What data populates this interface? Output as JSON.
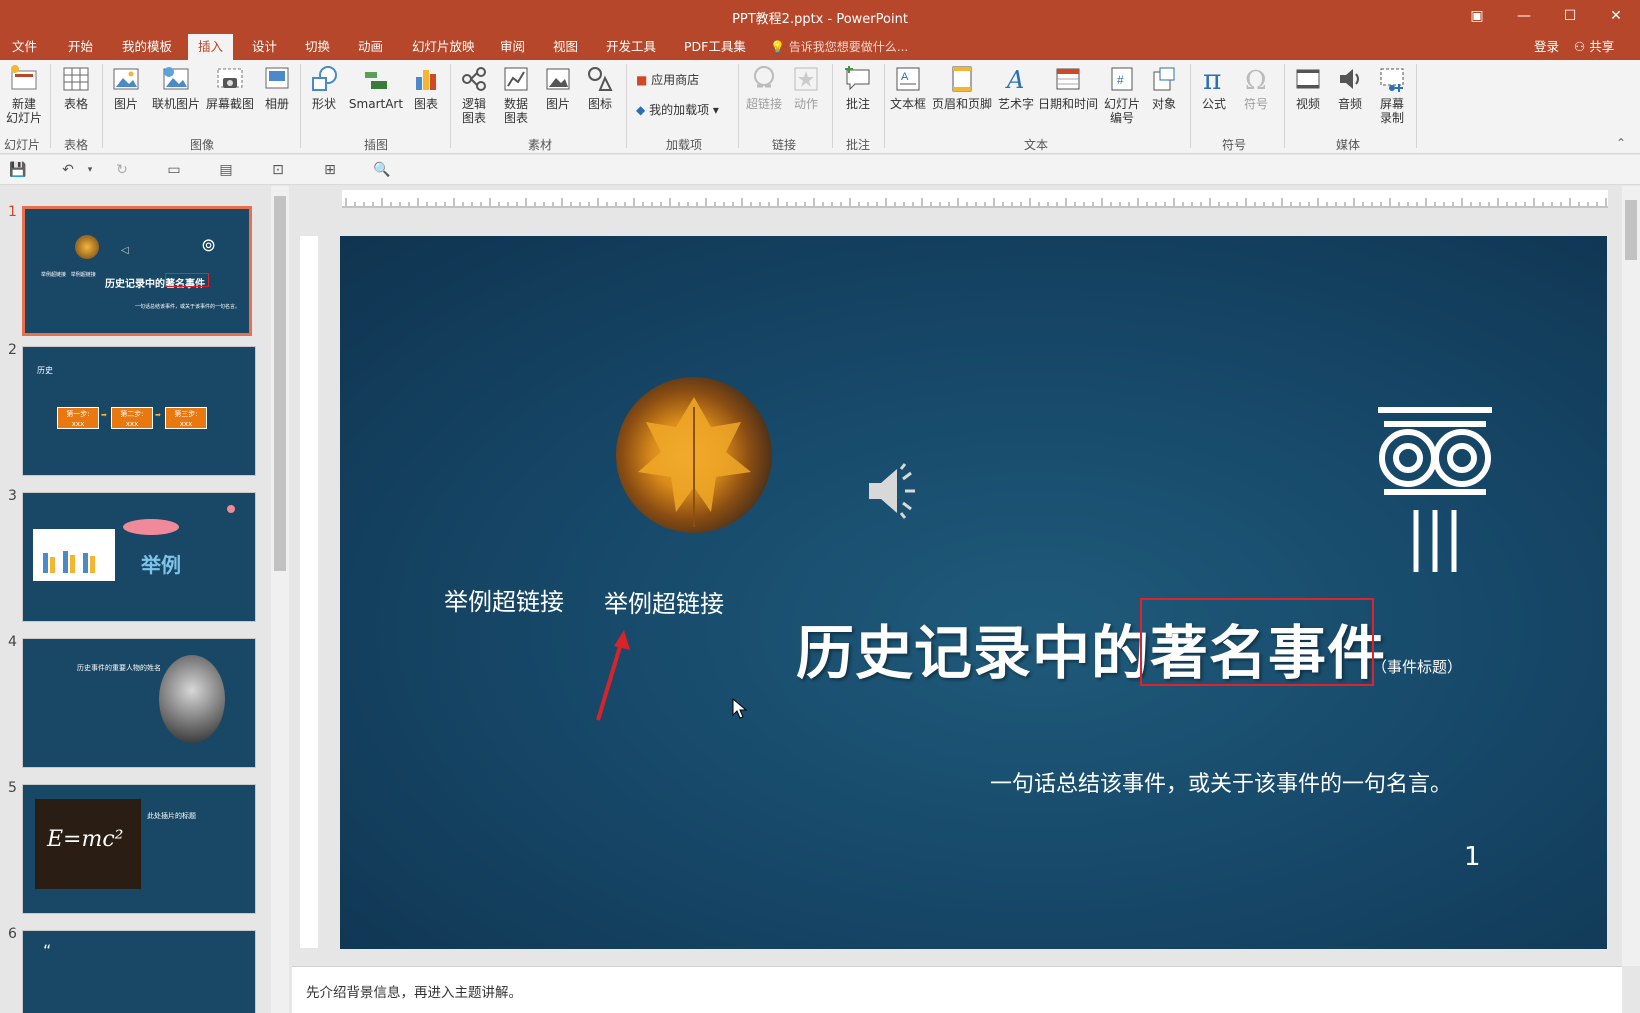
{
  "window": {
    "title": "PPT教程2.pptx - PowerPoint"
  },
  "tabs": [
    "文件",
    "开始",
    "我的模板",
    "插入",
    "设计",
    "切换",
    "动画",
    "幻灯片放映",
    "审阅",
    "视图",
    "开发工具",
    "PDF工具集"
  ],
  "active_tab": "插入",
  "tell_me": "告诉我您想要做什么...",
  "account": {
    "login": "登录",
    "share": "共享"
  },
  "ribbon": {
    "new_slide": "新建\n幻灯片",
    "table": "表格",
    "picture": "图片",
    "online_picture": "联机图片",
    "screenshot": "屏幕截图",
    "album": "相册",
    "shapes": "形状",
    "smartart": "SmartArt",
    "chart": "图表",
    "logic_chart": "逻辑\n图表",
    "data_chart": "数据\n图表",
    "material_picture": "图片",
    "icon": "图标",
    "app_store": "应用商店",
    "my_addins": "我的加载项",
    "hyperlink": "超链接",
    "action": "动作",
    "comment": "批注",
    "textbox": "文本框",
    "header_footer": "页眉和页脚",
    "wordart": "艺术字",
    "datetime": "日期和时间",
    "slide_number": "幻灯片\n编号",
    "object": "对象",
    "equation": "公式",
    "symbol": "符号",
    "video": "视频",
    "audio": "音频",
    "screen_record": "屏幕\n录制",
    "groups": {
      "slides": "幻灯片",
      "tables": "表格",
      "images": "图像",
      "illustrations": "插图",
      "material": "素材",
      "addins": "加载项",
      "links": "链接",
      "comments": "批注",
      "text": "文本",
      "symbols": "符号",
      "media": "媒体"
    }
  },
  "thumbnails": {
    "numbers": [
      "1",
      "2",
      "3",
      "4",
      "5",
      "6"
    ],
    "t1_title": "历史记录中的著名事件",
    "t2_title": "历史",
    "t2_steps": [
      "第一步:",
      "第二步:",
      "第三步:"
    ],
    "t3_title": "举例",
    "t4_title": "历史事件的重要人物的姓名",
    "t5_title": "此处插片的标题",
    "t5_formula": "E=mc²"
  },
  "slide": {
    "link1": "举例超链接",
    "link2": "举例超链接",
    "title_part1": "历史记录中的",
    "title_part2": "著名事件",
    "title_note": "（事件标题）",
    "subtitle": "一句话总结该事件，或关于该事件的一句名言。",
    "page_number": "1"
  },
  "notes": "先介绍背景信息，再进入主题讲解。",
  "colors": {
    "accent": "#b7472a",
    "slide_bg": "#184866",
    "highlight_box": "#e0232b",
    "thumb_selected": "#e8704f"
  }
}
